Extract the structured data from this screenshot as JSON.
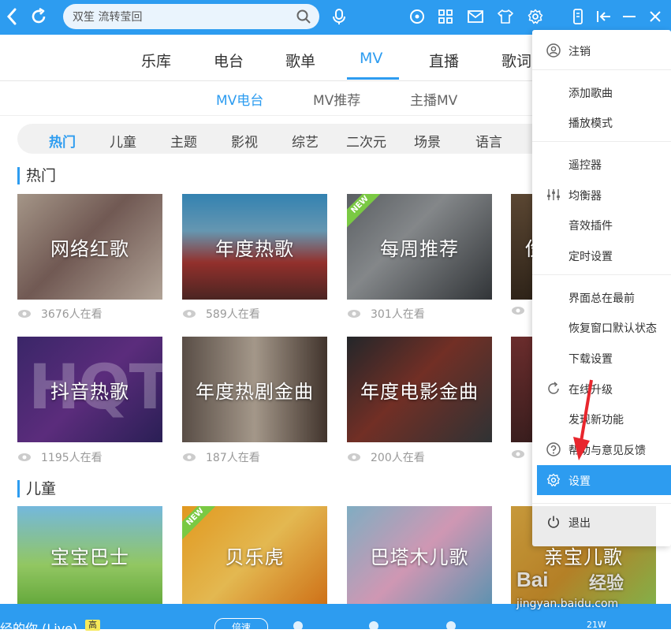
{
  "colors": {
    "accent": "#2d9cf0",
    "menu_active": "#2d9cf0",
    "new_badge": "#7ac943",
    "arrow": "#e8262d"
  },
  "search": {
    "value": "双笙 流转莹回",
    "placeholder": ""
  },
  "main_tabs": [
    {
      "label": "乐库"
    },
    {
      "label": "电台"
    },
    {
      "label": "歌单"
    },
    {
      "label": "MV"
    },
    {
      "label": "直播"
    },
    {
      "label": "歌词"
    }
  ],
  "sub_tabs": [
    {
      "label": "MV电台"
    },
    {
      "label": "MV推荐"
    },
    {
      "label": "主播MV"
    }
  ],
  "categories": [
    {
      "label": "热门"
    },
    {
      "label": "儿童"
    },
    {
      "label": "主题"
    },
    {
      "label": "影视"
    },
    {
      "label": "综艺"
    },
    {
      "label": "二次元"
    },
    {
      "label": "场景"
    },
    {
      "label": "语言"
    }
  ],
  "sections": [
    {
      "title": "热门"
    },
    {
      "title": "儿童"
    }
  ],
  "cards_row1": [
    {
      "title": "网络红歌",
      "views": "3676人在看",
      "badge": ""
    },
    {
      "title": "年度热歌",
      "views": "589人在看",
      "badge": ""
    },
    {
      "title": "每周推荐",
      "views": "301人在看",
      "badge": "NEW"
    },
    {
      "title": "伤",
      "views": "",
      "badge": ""
    }
  ],
  "cards_row2": [
    {
      "title": "抖音热歌",
      "views": "1195人在看",
      "overlay": "HQT"
    },
    {
      "title": "年度热剧金曲",
      "views": "187人在看"
    },
    {
      "title": "年度电影金曲",
      "views": "200人在看"
    },
    {
      "title": "",
      "views": ""
    }
  ],
  "cards_row3": [
    {
      "title": "宝宝巴士",
      "badge": ""
    },
    {
      "title": "贝乐虎",
      "badge": "NEW"
    },
    {
      "title": "巴塔木儿歌",
      "badge": ""
    },
    {
      "title": "亲宝儿歌",
      "badge": ""
    }
  ],
  "menu": {
    "items": [
      {
        "label": "注销",
        "icon": "user-icon"
      },
      {
        "label": "添加歌曲",
        "icon": ""
      },
      {
        "label": "播放模式",
        "icon": ""
      },
      {
        "label": "遥控器",
        "icon": ""
      },
      {
        "label": "均衡器",
        "icon": "equalizer-icon"
      },
      {
        "label": "音效插件",
        "icon": ""
      },
      {
        "label": "定时设置",
        "icon": ""
      },
      {
        "label": "界面总在最前",
        "icon": ""
      },
      {
        "label": "恢复窗口默认状态",
        "icon": ""
      },
      {
        "label": "下载设置",
        "icon": ""
      },
      {
        "label": "在线升级",
        "icon": "refresh-icon"
      },
      {
        "label": "发现新功能",
        "icon": ""
      },
      {
        "label": "帮助与意见反馈",
        "icon": "help-icon"
      },
      {
        "label": "设置",
        "icon": "gear-icon"
      },
      {
        "label": "退出",
        "icon": "power-icon"
      }
    ]
  },
  "player": {
    "song": "经的你 (Live)",
    "quality": "高",
    "speed": "倍速",
    "bitrate": "21W"
  },
  "watermark": {
    "logo": "Bai",
    "cn": "经验",
    "url": "jingyan.baidu.com"
  }
}
